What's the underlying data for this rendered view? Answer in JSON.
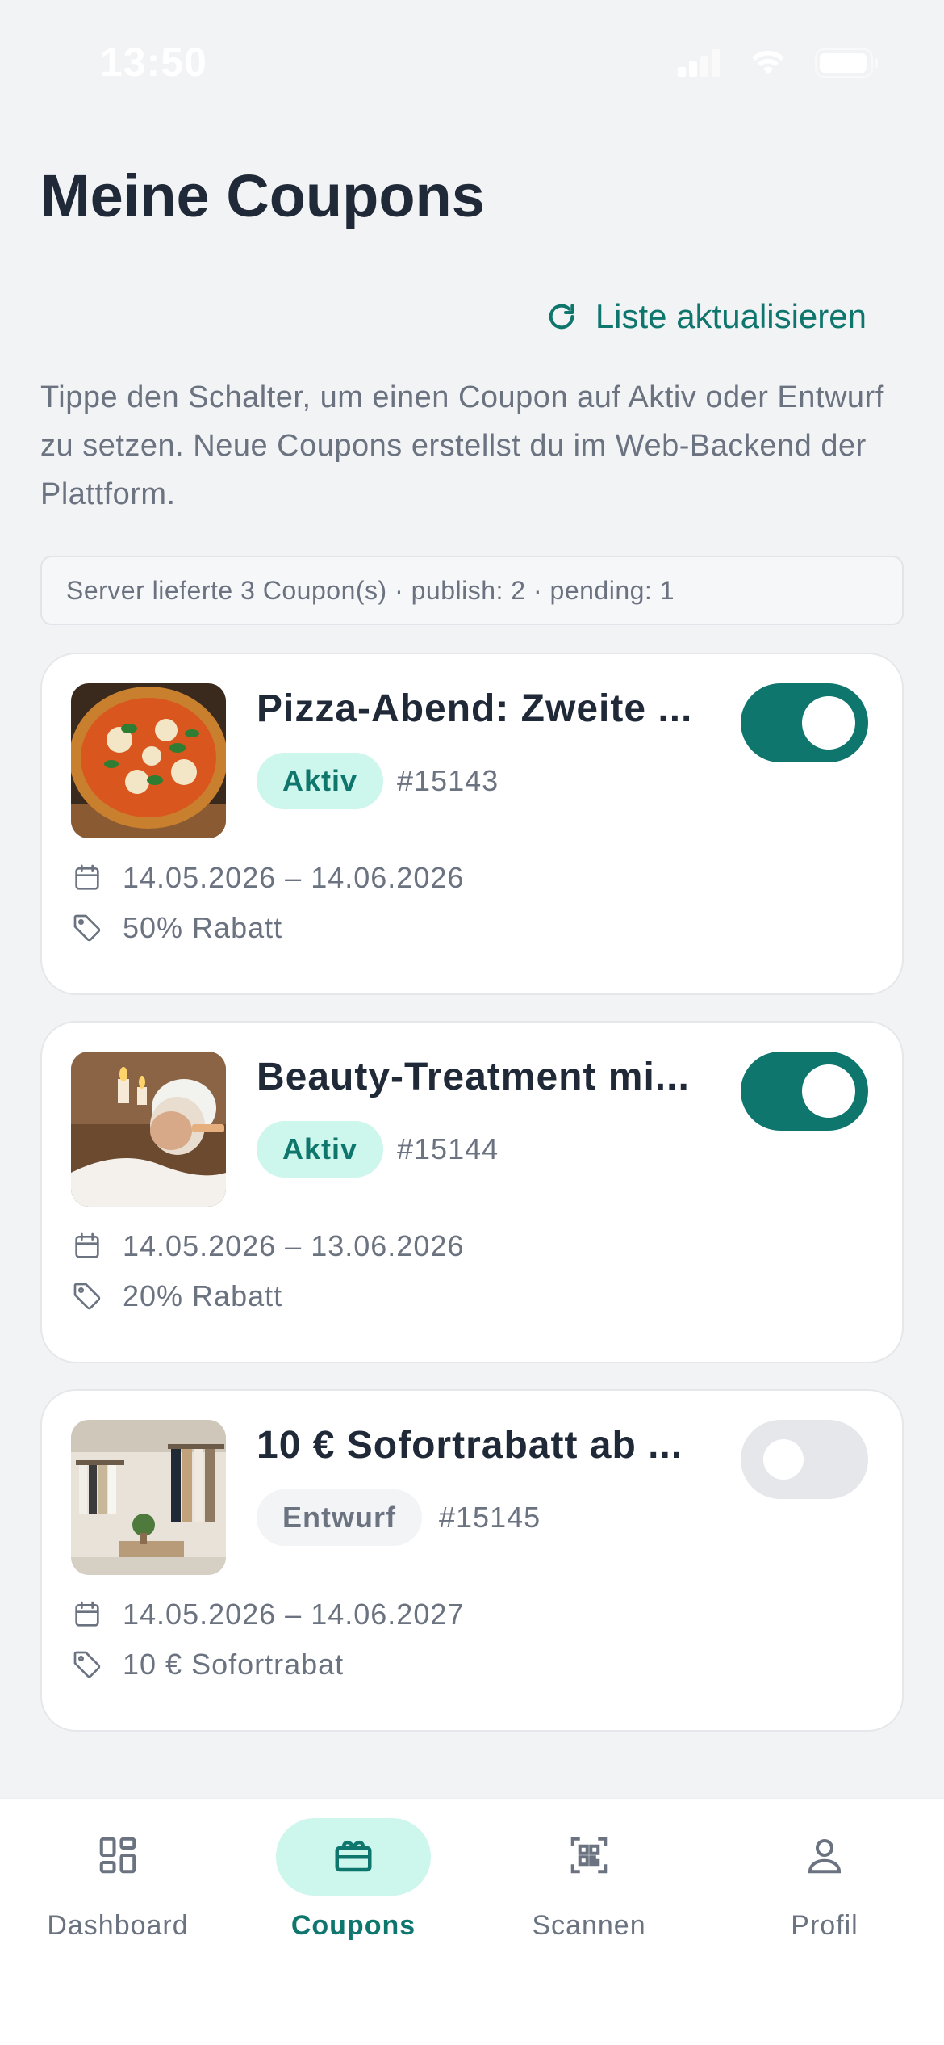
{
  "status_bar": {
    "time": "13:50"
  },
  "page": {
    "title": "Meine Coupons",
    "refresh_label": "Liste aktualisieren",
    "hint": "Tippe den Schalter, um einen Coupon auf Aktiv oder Entwurf zu setzen. Neue Coupons erstellst du im Web-Backend der Plattform.",
    "server_info": "Server lieferte 3 Coupon(s) · publish: 2 · pending: 1"
  },
  "colors": {
    "accent": "#0f766e",
    "accent_light": "#cdf6ec",
    "background": "#f2f3f5"
  },
  "coupons": [
    {
      "title": "Pizza-Abend: Zweite ...",
      "status": "Aktiv",
      "id": "#15143",
      "toggle_on": true,
      "dates": "14.05.2026 – 14.06.2026",
      "discount": "50% Rabatt",
      "image_icon": "pizza-image"
    },
    {
      "title": "Beauty-Treatment mi...",
      "status": "Aktiv",
      "id": "#15144",
      "toggle_on": true,
      "dates": "14.05.2026 – 13.06.2026",
      "discount": "20% Rabatt",
      "image_icon": "spa-image"
    },
    {
      "title": "10 € Sofortrabatt ab ...",
      "status": "Entwurf",
      "id": "#15145",
      "toggle_on": false,
      "dates": "14.05.2026 – 14.06.2027",
      "discount": "10 € Sofortrabat",
      "image_icon": "clothing-store-image"
    }
  ],
  "nav": {
    "items": [
      {
        "label": "Dashboard",
        "icon": "dashboard-icon",
        "active": false
      },
      {
        "label": "Coupons",
        "icon": "coupon-icon",
        "active": true
      },
      {
        "label": "Scannen",
        "icon": "qr-scan-icon",
        "active": false
      },
      {
        "label": "Profil",
        "icon": "profile-icon",
        "active": false
      }
    ]
  }
}
